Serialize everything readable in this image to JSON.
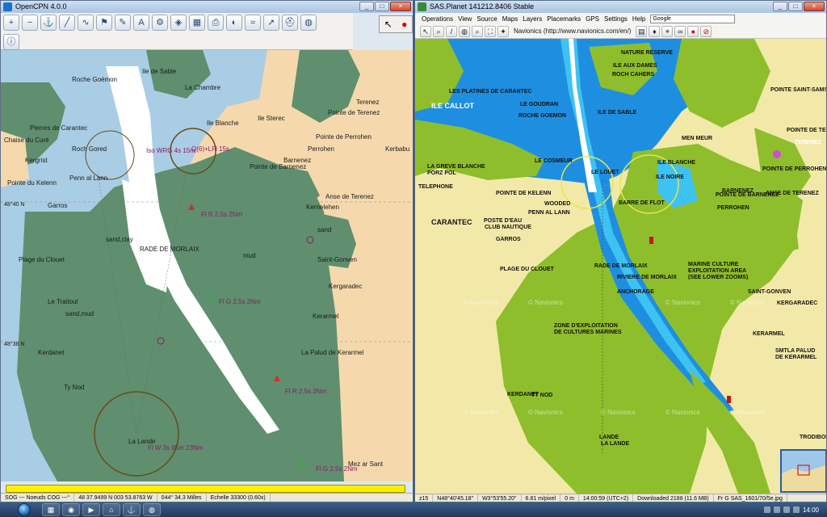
{
  "left_window": {
    "title": "OpenCPN 4.0.0",
    "toolbar_icons": [
      "zoom-in-icon",
      "zoom-out-icon",
      "chart-scale-icon",
      "route-icon",
      "track-icon",
      "waypoint-icon",
      "measure-icon",
      "text-icon",
      "settings-icon",
      "ais-icon",
      "chart-quilt-icon",
      "print-icon",
      "toggle-icon",
      "tide-icon",
      "current-icon",
      "mob-icon",
      "world-icon",
      "info-icon"
    ],
    "corner_buttons": [
      "↖",
      "●"
    ],
    "chart_labels": [
      {
        "t": "Roche Goémon"
      },
      {
        "t": "Ile de Sable"
      },
      {
        "t": "La Chambre"
      },
      {
        "t": "Ile Blanche"
      },
      {
        "t": "Ile Sterec"
      },
      {
        "t": "Pointe de Terenez"
      },
      {
        "t": "Terenez"
      },
      {
        "t": "Pointe de Perrohen"
      },
      {
        "t": "Perrohen"
      },
      {
        "t": "Kerbabu"
      },
      {
        "t": "Roch Gored"
      },
      {
        "t": "Kergrist"
      },
      {
        "t": "Penn al Lann"
      },
      {
        "t": "Barnenez"
      },
      {
        "t": "Pointe de Barnenez"
      },
      {
        "t": "Pointe du Kelenn"
      },
      {
        "t": "Anse de Terenez"
      },
      {
        "t": "Kernelehen"
      },
      {
        "t": "Garros"
      },
      {
        "t": "sand,clay"
      },
      {
        "t": "sand"
      },
      {
        "t": "Saint-Gonven"
      },
      {
        "t": "mud"
      },
      {
        "t": "Plage du Clouet"
      },
      {
        "t": "RADE DE MORLAIX"
      },
      {
        "t": "Kergaradec"
      },
      {
        "t": "Le Traitoul"
      },
      {
        "t": "sand,mud"
      },
      {
        "t": "Kerarmel"
      },
      {
        "t": "La Palud de Kerarmel"
      },
      {
        "t": "Kerdanet"
      },
      {
        "t": "Ty Nod"
      },
      {
        "t": "Fl R 2.5s 2Nm"
      },
      {
        "t": "Fl G 2.5s 2Nm"
      },
      {
        "t": "Fl R 2.5s 2Nm"
      },
      {
        "t": "Fl W 3s 85m 23Nm"
      },
      {
        "t": "La Lande"
      },
      {
        "t": "Mez ar Sant"
      },
      {
        "t": "Fl G 2.5s 2Nm"
      },
      {
        "t": "Iso WRG 4s 15m"
      },
      {
        "t": "Q(6)+LFl 15s"
      },
      {
        "t": "Chaise du Curé"
      },
      {
        "t": "Pierres de Carantec"
      },
      {
        "t": "48°40 N"
      },
      {
        "t": "48°38 N"
      }
    ],
    "status": [
      "SOG --- Noeuds COG ---°",
      "48 37.9499 N  003 53.8763 W",
      "044°  34.3 Milles",
      "Echelle 33300 (0.60x)"
    ]
  },
  "right_window": {
    "title": "SAS.Planet 141212.8406 Stable",
    "menu": [
      "Operations",
      "View",
      "Source",
      "Maps",
      "Layers",
      "Placemarks",
      "GPS",
      "Settings",
      "Help"
    ],
    "search_value": "Google",
    "map_source": "Navionics (http://www.navionics.com/en/)",
    "nav_labels": [
      {
        "t": "NATURE RESERVE"
      },
      {
        "t": "ILE AUX DAMES"
      },
      {
        "t": "ROCH CAHERS"
      },
      {
        "t": "ILE CALLOT"
      },
      {
        "t": "LES PLATINES DE CARANTEC"
      },
      {
        "t": "LE GOUDRAN"
      },
      {
        "t": "ROCHE GOEMON"
      },
      {
        "t": "ILE DE SABLE"
      },
      {
        "t": "MEN MEUR"
      },
      {
        "t": "POINTE SAINT-SAMSON"
      },
      {
        "t": "POINTE DE TERENEZ"
      },
      {
        "t": "TERENEZ"
      },
      {
        "t": "LE COSMEUR"
      },
      {
        "t": "LE LOUET"
      },
      {
        "t": "ILE BLANCHE"
      },
      {
        "t": "ILE NOIRE"
      },
      {
        "t": "POINTE DE PERROHEN"
      },
      {
        "t": "BARNENEZ"
      },
      {
        "t": "POINTE DE BARNENEZ"
      },
      {
        "t": "ANSE DE TERENEZ"
      },
      {
        "t": "PERROHEN"
      },
      {
        "t": "LA GREVE BLANCHE"
      },
      {
        "t": "PORZ POL"
      },
      {
        "t": "TELEPHONE"
      },
      {
        "t": "POINTE DE KELENN"
      },
      {
        "t": "CARANTEC"
      },
      {
        "t": "POSTE D'EAU"
      },
      {
        "t": "CLUB NAUTIQUE"
      },
      {
        "t": "GARROS"
      },
      {
        "t": "PENN AL LANN"
      },
      {
        "t": "WOODED"
      },
      {
        "t": "BARRE DE FLOT"
      },
      {
        "t": "PLAGE DU CLOUET"
      },
      {
        "t": "RADE DE MORLAIX"
      },
      {
        "t": "RIVIERE DE MORLAIX"
      },
      {
        "t": "ANCHORAGE"
      },
      {
        "t": "MARINE CULTURE"
      },
      {
        "t": "EXPLOITATION AREA"
      },
      {
        "t": "(SEE LOWER ZOOMS)"
      },
      {
        "t": "SAINT-GONVEN"
      },
      {
        "t": "KERGARADEC"
      },
      {
        "t": "ZONE D'EXPLOITATION"
      },
      {
        "t": "DE CULTURES MARINES"
      },
      {
        "t": "KERARMEL"
      },
      {
        "t": "SMTLA PALUD"
      },
      {
        "t": "DE KERARMEL"
      },
      {
        "t": "KERDANET"
      },
      {
        "t": "TY NOD"
      },
      {
        "t": "LANDE"
      },
      {
        "t": "LA LANDE"
      },
      {
        "t": "TRODIBON"
      }
    ],
    "watermark": "© Navionics",
    "status": [
      "z15",
      "N48°40'45.18\"",
      "W3°53'55.20\"",
      "6.81 m/pixel",
      "0 m",
      "14:00:59 (UTC+2)",
      "Downloaded 2188 (11.6 MB)",
      "Fr G SAS_1601/70/5e.jpg"
    ]
  },
  "taskbar": {
    "clock": "14:00"
  },
  "colors": {
    "chart_land": "#f5d9ad",
    "chart_drying": "#5f8f6e",
    "chart_shallow": "#a9cde4",
    "chart_deep": "#ffffff",
    "nav_land": "#f2e9a8",
    "nav_green": "#8ebe2b",
    "nav_blue": "#1e8fe0",
    "nav_light": "#3ec2f2"
  }
}
